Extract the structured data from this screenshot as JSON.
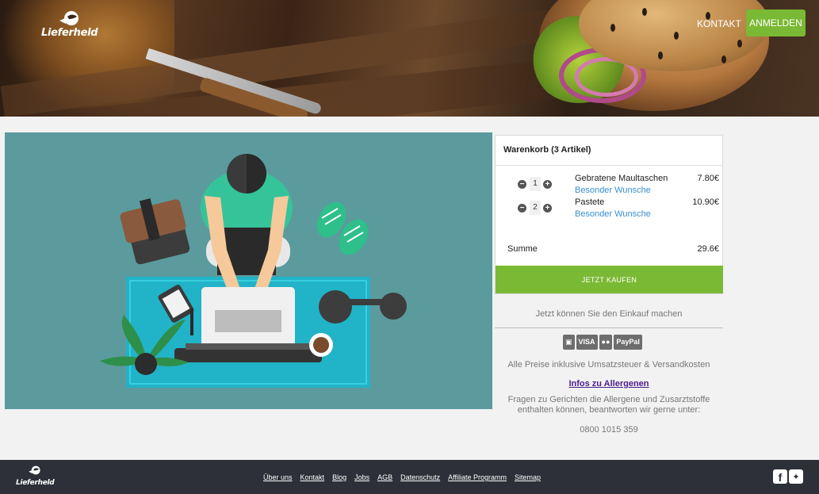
{
  "header": {
    "brand": "Lieferheld",
    "nav_kontakt": "KONTAKT",
    "nav_anmelden": "ANMELDEN"
  },
  "cart": {
    "title": "Warenkorb (3 Artikel)",
    "items": [
      {
        "qty": "1",
        "name": "Gebratene Maultaschen",
        "wish": "Besonder Wunsche",
        "price": "7.80€"
      },
      {
        "qty": "2",
        "name": "Pastete",
        "wish": "Besonder Wunsche",
        "price": "10.90€"
      }
    ],
    "summe_label": "Summe",
    "summe_value": "29.6€",
    "buy_label": "JETZT KAUFEN"
  },
  "info": {
    "now": "Jetzt können Sie den Einkauf machen",
    "payment": [
      "VISA",
      "PayPal"
    ],
    "prices": "Alle Preise inklusive Umsatzsteuer & Versandkosten",
    "allergen_link": "Infos zu Allergenen",
    "fragen": "Fragen zu Gerichten die Allergene und Zusarztstoffe enthalten können, beantworten wir gerne unter:",
    "phone": "0800 1015 359"
  },
  "footer": {
    "brand": "Lieferheld",
    "links": [
      "Über uns",
      "Kontakt",
      "Blog",
      "Jobs",
      "AGB",
      "Datenschutz",
      "Affiliate Programm",
      "Sitemap"
    ]
  },
  "colors": {
    "green": "#7ab934",
    "footer": "#2d3038",
    "link": "#3a8fd0",
    "hero_bg": "#5a9a9c"
  }
}
